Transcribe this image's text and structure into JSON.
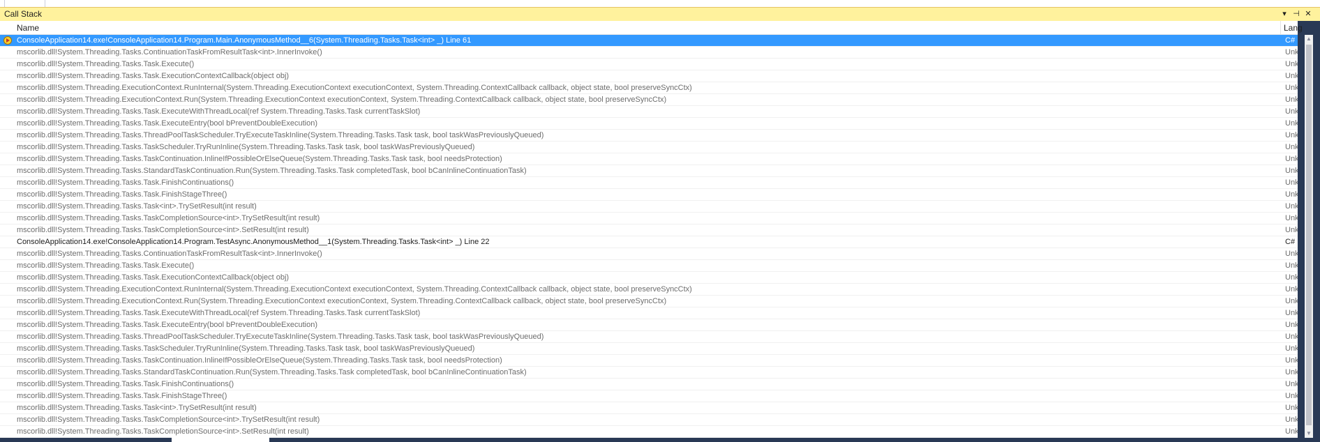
{
  "window": {
    "title": "Call Stack",
    "pin_glyph": "▾",
    "autohide_glyph": "⊣",
    "close_glyph": "✕"
  },
  "columns": {
    "name": "Name",
    "language": "Lang"
  },
  "rows": [
    {
      "name": "ConsoleApplication14.exe!ConsoleApplication14.Program.Main.AnonymousMethod__6(System.Threading.Tasks.Task<int> _) Line 61",
      "lang": "C#",
      "type": "selected"
    },
    {
      "name": "mscorlib.dll!System.Threading.Tasks.ContinuationTaskFromResultTask<int>.InnerInvoke()",
      "lang": "Unkn",
      "type": "external"
    },
    {
      "name": "mscorlib.dll!System.Threading.Tasks.Task.Execute()",
      "lang": "Unkn",
      "type": "external"
    },
    {
      "name": "mscorlib.dll!System.Threading.Tasks.Task.ExecutionContextCallback(object obj)",
      "lang": "Unkn",
      "type": "external"
    },
    {
      "name": "mscorlib.dll!System.Threading.ExecutionContext.RunInternal(System.Threading.ExecutionContext executionContext, System.Threading.ContextCallback callback, object state, bool preserveSyncCtx)",
      "lang": "Unkn",
      "type": "external"
    },
    {
      "name": "mscorlib.dll!System.Threading.ExecutionContext.Run(System.Threading.ExecutionContext executionContext, System.Threading.ContextCallback callback, object state, bool preserveSyncCtx)",
      "lang": "Unkn",
      "type": "external"
    },
    {
      "name": "mscorlib.dll!System.Threading.Tasks.Task.ExecuteWithThreadLocal(ref System.Threading.Tasks.Task currentTaskSlot)",
      "lang": "Unkn",
      "type": "external"
    },
    {
      "name": "mscorlib.dll!System.Threading.Tasks.Task.ExecuteEntry(bool bPreventDoubleExecution)",
      "lang": "Unkn",
      "type": "external"
    },
    {
      "name": "mscorlib.dll!System.Threading.Tasks.ThreadPoolTaskScheduler.TryExecuteTaskInline(System.Threading.Tasks.Task task, bool taskWasPreviouslyQueued)",
      "lang": "Unkn",
      "type": "external"
    },
    {
      "name": "mscorlib.dll!System.Threading.Tasks.TaskScheduler.TryRunInline(System.Threading.Tasks.Task task, bool taskWasPreviouslyQueued)",
      "lang": "Unkn",
      "type": "external"
    },
    {
      "name": "mscorlib.dll!System.Threading.Tasks.TaskContinuation.InlineIfPossibleOrElseQueue(System.Threading.Tasks.Task task, bool needsProtection)",
      "lang": "Unkn",
      "type": "external"
    },
    {
      "name": "mscorlib.dll!System.Threading.Tasks.StandardTaskContinuation.Run(System.Threading.Tasks.Task completedTask, bool bCanInlineContinuationTask)",
      "lang": "Unkn",
      "type": "external"
    },
    {
      "name": "mscorlib.dll!System.Threading.Tasks.Task.FinishContinuations()",
      "lang": "Unkn",
      "type": "external"
    },
    {
      "name": "mscorlib.dll!System.Threading.Tasks.Task.FinishStageThree()",
      "lang": "Unkn",
      "type": "external"
    },
    {
      "name": "mscorlib.dll!System.Threading.Tasks.Task<int>.TrySetResult(int result)",
      "lang": "Unkn",
      "type": "external"
    },
    {
      "name": "mscorlib.dll!System.Threading.Tasks.TaskCompletionSource<int>.TrySetResult(int result)",
      "lang": "Unkn",
      "type": "external"
    },
    {
      "name": "mscorlib.dll!System.Threading.Tasks.TaskCompletionSource<int>.SetResult(int result)",
      "lang": "Unkn",
      "type": "external"
    },
    {
      "name": "ConsoleApplication14.exe!ConsoleApplication14.Program.TestAsync.AnonymousMethod__1(System.Threading.Tasks.Task<int> _) Line 22",
      "lang": "C#",
      "type": "user"
    },
    {
      "name": "mscorlib.dll!System.Threading.Tasks.ContinuationTaskFromResultTask<int>.InnerInvoke()",
      "lang": "Unkn",
      "type": "external"
    },
    {
      "name": "mscorlib.dll!System.Threading.Tasks.Task.Execute()",
      "lang": "Unkn",
      "type": "external"
    },
    {
      "name": "mscorlib.dll!System.Threading.Tasks.Task.ExecutionContextCallback(object obj)",
      "lang": "Unkn",
      "type": "external"
    },
    {
      "name": "mscorlib.dll!System.Threading.ExecutionContext.RunInternal(System.Threading.ExecutionContext executionContext, System.Threading.ContextCallback callback, object state, bool preserveSyncCtx)",
      "lang": "Unkn",
      "type": "external"
    },
    {
      "name": "mscorlib.dll!System.Threading.ExecutionContext.Run(System.Threading.ExecutionContext executionContext, System.Threading.ContextCallback callback, object state, bool preserveSyncCtx)",
      "lang": "Unkn",
      "type": "external"
    },
    {
      "name": "mscorlib.dll!System.Threading.Tasks.Task.ExecuteWithThreadLocal(ref System.Threading.Tasks.Task currentTaskSlot)",
      "lang": "Unkn",
      "type": "external"
    },
    {
      "name": "mscorlib.dll!System.Threading.Tasks.Task.ExecuteEntry(bool bPreventDoubleExecution)",
      "lang": "Unkn",
      "type": "external"
    },
    {
      "name": "mscorlib.dll!System.Threading.Tasks.ThreadPoolTaskScheduler.TryExecuteTaskInline(System.Threading.Tasks.Task task, bool taskWasPreviouslyQueued)",
      "lang": "Unkn",
      "type": "external"
    },
    {
      "name": "mscorlib.dll!System.Threading.Tasks.TaskScheduler.TryRunInline(System.Threading.Tasks.Task task, bool taskWasPreviouslyQueued)",
      "lang": "Unkn",
      "type": "external"
    },
    {
      "name": "mscorlib.dll!System.Threading.Tasks.TaskContinuation.InlineIfPossibleOrElseQueue(System.Threading.Tasks.Task task, bool needsProtection)",
      "lang": "Unkn",
      "type": "external"
    },
    {
      "name": "mscorlib.dll!System.Threading.Tasks.StandardTaskContinuation.Run(System.Threading.Tasks.Task completedTask, bool bCanInlineContinuationTask)",
      "lang": "Unkn",
      "type": "external"
    },
    {
      "name": "mscorlib.dll!System.Threading.Tasks.Task.FinishContinuations()",
      "lang": "Unkn",
      "type": "external"
    },
    {
      "name": "mscorlib.dll!System.Threading.Tasks.Task.FinishStageThree()",
      "lang": "Unkn",
      "type": "external"
    },
    {
      "name": "mscorlib.dll!System.Threading.Tasks.Task<int>.TrySetResult(int result)",
      "lang": "Unkn",
      "type": "external"
    },
    {
      "name": "mscorlib.dll!System.Threading.Tasks.TaskCompletionSource<int>.TrySetResult(int result)",
      "lang": "Unkn",
      "type": "external"
    },
    {
      "name": "mscorlib.dll!System.Threading.Tasks.TaskCompletionSource<int>.SetResult(int result)",
      "lang": "Unkn",
      "type": "external"
    }
  ],
  "colors": {
    "title_bar": "#FFF29D",
    "selection": "#3399FF",
    "external_text": "#6D6D6D",
    "user_text": "#1E1E1E",
    "chrome": "#293955"
  }
}
